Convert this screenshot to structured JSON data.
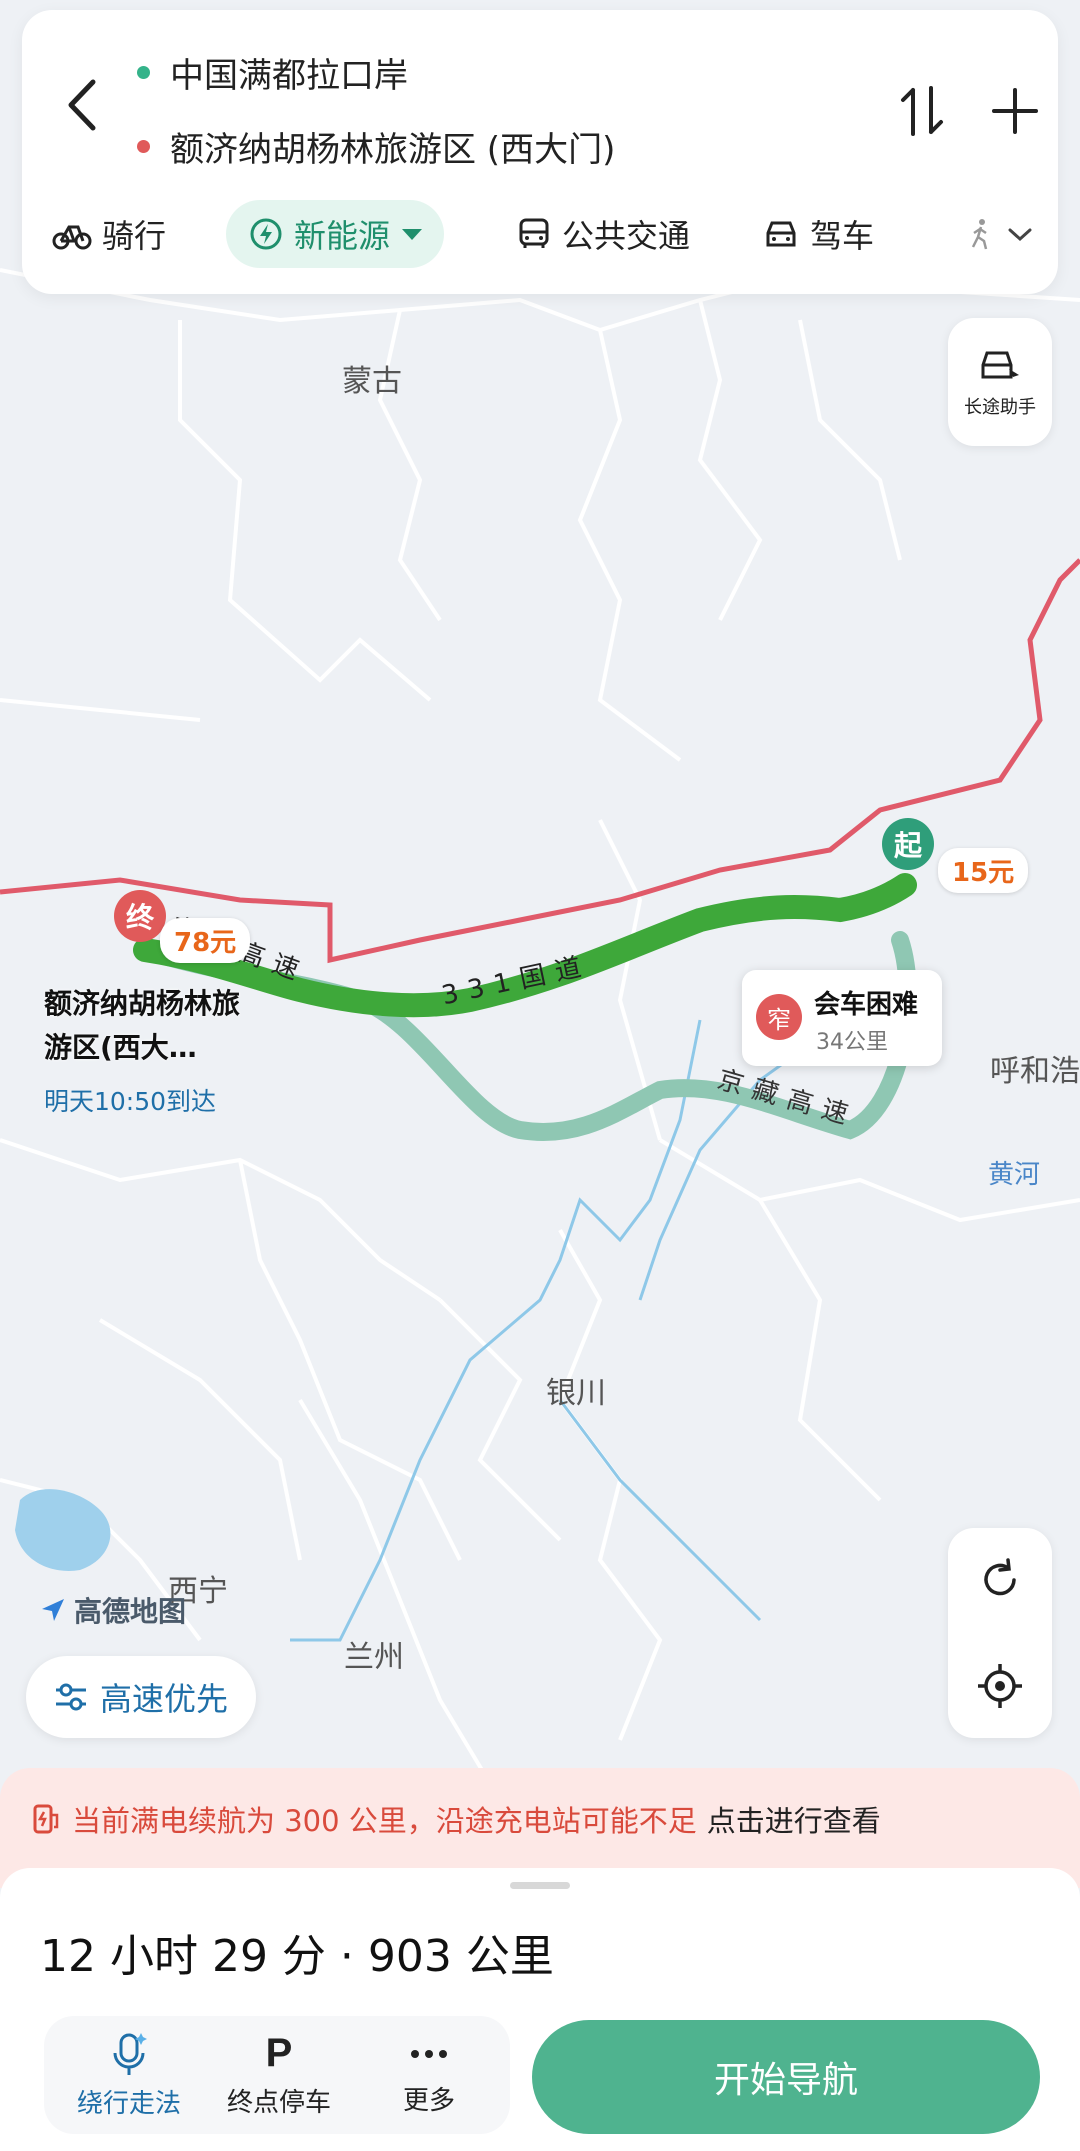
{
  "route": {
    "start": "中国满都拉口岸",
    "end": "额济纳胡杨林旅游区 (西大门)"
  },
  "modes": [
    {
      "label": "骑行",
      "icon": "bicycle-icon"
    },
    {
      "label": "新能源",
      "icon": "ev-charge-icon",
      "active": true
    },
    {
      "label": "公共交通",
      "icon": "bus-icon"
    },
    {
      "label": "驾车",
      "icon": "car-icon"
    }
  ],
  "assist": {
    "label": "长途助手"
  },
  "map": {
    "labels": {
      "mongolia": "蒙古",
      "yinchuan": "银川",
      "xining": "西宁",
      "lanzhou": "兰州",
      "hohhot": "呼和浩",
      "yellow_river": "黄河"
    },
    "roads": {
      "jingxin": "京新高速",
      "g331": "331国道",
      "jingzang": "京藏高速"
    },
    "logo": "高德地图",
    "start_badge": "起",
    "end_badge": "终",
    "start_cost": "15元",
    "end_cost": "78元",
    "dest_label": "额济纳胡杨林旅游区(西大…",
    "eta": "明天10:50到达",
    "callout": {
      "icon_text": "窄",
      "title": "会车困难",
      "distance": "34公里"
    },
    "colors": {
      "route_main": "#3ea83a",
      "route_alt": "#8fc7b3",
      "border": "#e05a6a",
      "accent": "#4fb38f"
    }
  },
  "preference": {
    "label": "高速优先"
  },
  "warning": {
    "text": "当前满电续航为 300 公里，沿途充电站可能不足",
    "link": "点击进行查看"
  },
  "summary": {
    "text": "12 小时 29 分 · 903 公里"
  },
  "actions": [
    {
      "label": "绕行走法",
      "icon": "mic-icon"
    },
    {
      "label": "终点停车",
      "icon": "parking-icon",
      "glyph": "P"
    },
    {
      "label": "更多",
      "icon": "more-icon"
    }
  ],
  "start_nav": {
    "label": "开始导航"
  }
}
